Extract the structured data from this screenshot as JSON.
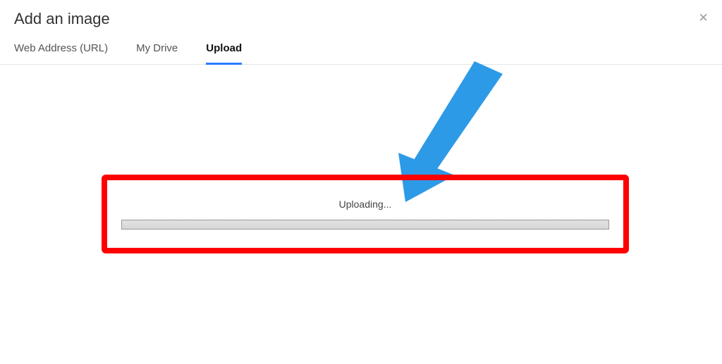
{
  "dialog": {
    "title": "Add an image",
    "close_symbol": "×"
  },
  "tabs": {
    "web_address": "Web Address (URL)",
    "my_drive": "My Drive",
    "upload": "Upload"
  },
  "upload": {
    "status_text": "Uploading..."
  },
  "annotation": {
    "arrow_color": "#2d9ae7",
    "highlight_color": "#ff0000"
  }
}
